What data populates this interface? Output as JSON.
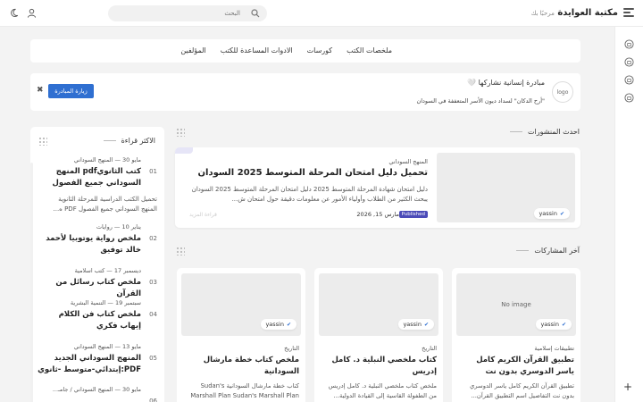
{
  "header": {
    "brand": "مكتبة العوايدة",
    "greeting": "مرحبًا بك",
    "search_placeholder": "البحث"
  },
  "nav": {
    "links": [
      "ملخصات الكتب",
      "كورسات",
      "الادوات المساعدة للكتب",
      "المؤلفين"
    ]
  },
  "banner": {
    "logo_alt": "logo",
    "title": "مبادرة إنسانية نشاركها 🤍",
    "subtitle": "\"أرح الدكان\" لسداد ديون الأسر المتعففة في السودان",
    "button": "زيارة المبادرة"
  },
  "sections": {
    "latest": "احدث المنشورات",
    "recent": "آخر المشاركات",
    "most_read": "الاكثر قراءة"
  },
  "featured": {
    "category": "المنهج السوداني",
    "title": "تحميل دليل امتحان المرحلة المتوسط 2025 السودان",
    "excerpt": "دليل امتحان شهادة المرحلة المتوسط 2025  دليل امتحان المرحلة المتوسط 2025 السودان يبحث الكثير من الطلاب وأولياء الأمور عن معلومات دقيقة حول امتحان ش...",
    "status": "Published",
    "date": "مارس 15, 2026",
    "author": "yassin",
    "ghost": "قراءة المزيد"
  },
  "cards": [
    {
      "category": "تطبيقات إسلامية",
      "title": "تطبيق القرآن الكريم كامل ياسر الدوسري بدون نت",
      "excerpt": "تطبيق القرآن الكريم  كامل ياسر الدوسري بدون نت التفاصيل اسم التطبيق القرآن...",
      "author": "yassin",
      "image": "No image"
    },
    {
      "category": "التاريخ",
      "title": "كتاب ملخصي النبلية د. كامل إدريس",
      "excerpt": "ملخص كتاب ملخصي النبلية د. كامل إدريس من الطفولة القاسية إلى القيادة الدولية...",
      "author": "yassin",
      "image": ""
    },
    {
      "category": "التاريخ",
      "title": "ملخص كتاب خطة مارشال السودانية",
      "excerpt": "كتاب  خطة مارشال السودانية  Sudan's Marshall Plan Sudan's Marshall Plan",
      "author": "yassin",
      "image": ""
    }
  ],
  "most_read": [
    {
      "num": "01",
      "date": "مايو 30",
      "category": "المنهج السوداني",
      "title": "كتب الثانويpdf المنهج السوداني جميع الفصول",
      "excerpt": "تحميل الكتب الدراسية للمرحلة الثانوية المنهج السوداني جميع الفصول PDF ه..."
    },
    {
      "num": "02",
      "date": "يناير 10",
      "category": "روايات",
      "title": "ملخص رواية يوتوبيا لأحمد خالد توفيق"
    },
    {
      "num": "03",
      "date": "ديسمبر 17",
      "category": "كتب اسلامية",
      "title": "ملخص كتاب رسائل من القرآن"
    },
    {
      "num": "04",
      "date": "سبتمبر 19",
      "category": "التنمية البشرية",
      "title": "ملخص كتاب فن الكلام إيهاب فكري"
    },
    {
      "num": "05",
      "date": "مايو 13",
      "category": "المنهج السوداني",
      "title": "المنهج السوداني الجديد PDF:إبتدائي-متوسط -ثانوي"
    },
    {
      "num": "06",
      "date": "مايو 30",
      "category": "المنهج السوداني / جامـ..."
    }
  ]
}
